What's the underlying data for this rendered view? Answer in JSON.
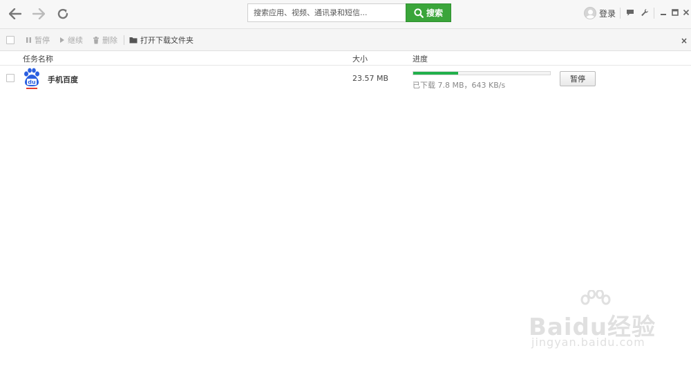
{
  "nav": {
    "back_icon": "arrow-left-icon",
    "forward_icon": "arrow-right-icon",
    "refresh_icon": "refresh-icon"
  },
  "search": {
    "placeholder": "搜索应用、视频、通讯录和短信...",
    "button_label": "搜索"
  },
  "account": {
    "login_label": "登录"
  },
  "toolbar": {
    "pause_label": "暂停",
    "resume_label": "继续",
    "delete_label": "删除",
    "open_folder_label": "打开下载文件夹",
    "close_label": "×"
  },
  "columns": {
    "name": "任务名称",
    "size": "大小",
    "progress": "进度"
  },
  "tasks": [
    {
      "name": "手机百度",
      "size": "23.57 MB",
      "progress_percent": 33,
      "status": "已下载 7.8 MB，643 KB/s",
      "action_label": "暂停"
    }
  ],
  "colors": {
    "accent": "#3aa53a",
    "progress": "#21b04b"
  },
  "watermark": {
    "brand": "Baidu经验",
    "url": "jingyan.baidu.com"
  }
}
